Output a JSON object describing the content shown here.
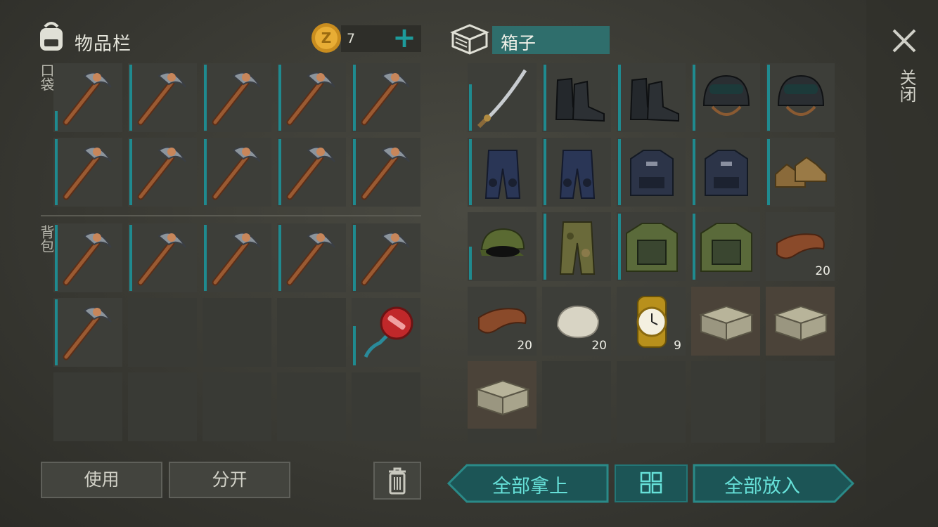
{
  "inventory": {
    "title": "物品栏",
    "coins": "7",
    "plus": "+",
    "pocket_label": "口袋",
    "backpack_label": "背包",
    "pocket": [
      {
        "item": "pickaxe-icon",
        "dur": 0.3
      },
      {
        "item": "pickaxe-icon",
        "dur": 1
      },
      {
        "item": "pickaxe-icon",
        "dur": 1
      },
      {
        "item": "pickaxe-icon",
        "dur": 1
      },
      {
        "item": "pickaxe-icon",
        "dur": 1
      },
      {
        "item": "pickaxe-icon",
        "dur": 1
      },
      {
        "item": "pickaxe-icon",
        "dur": 1
      },
      {
        "item": "pickaxe-icon",
        "dur": 1
      },
      {
        "item": "pickaxe-icon",
        "dur": 1
      },
      {
        "item": "pickaxe-icon",
        "dur": 1
      }
    ],
    "backpack": [
      {
        "item": "pickaxe-icon",
        "dur": 1
      },
      {
        "item": "pickaxe-icon",
        "dur": 1
      },
      {
        "item": "pickaxe-icon",
        "dur": 1
      },
      {
        "item": "pickaxe-icon",
        "dur": 1
      },
      {
        "item": "pickaxe-icon",
        "dur": 1
      },
      {
        "item": "pickaxe-icon",
        "dur": 1
      },
      {
        "item": null
      },
      {
        "item": null
      },
      {
        "item": null
      },
      {
        "item": "stop-sign-icon",
        "dur": 0.6
      },
      {
        "item": null
      },
      {
        "item": null
      },
      {
        "item": null
      },
      {
        "item": null
      },
      {
        "item": null
      }
    ],
    "use_label": "使用",
    "split_label": "分开"
  },
  "box": {
    "title": "箱子",
    "close_label": "关闭",
    "slots": [
      {
        "item": "katana-icon",
        "dur": 0.7
      },
      {
        "item": "boots-icon",
        "dur": 1
      },
      {
        "item": "boots-icon",
        "dur": 1
      },
      {
        "item": "helmet-icon",
        "dur": 1
      },
      {
        "item": "helmet-icon",
        "dur": 1
      },
      {
        "item": "pants-icon",
        "dur": 1
      },
      {
        "item": "pants-icon",
        "dur": 1
      },
      {
        "item": "vest-icon",
        "dur": 1
      },
      {
        "item": "vest-icon",
        "dur": 1
      },
      {
        "item": "shoes-icon",
        "dur": 1
      },
      {
        "item": "cap-icon",
        "dur": 0.5
      },
      {
        "item": "camo-pants-icon",
        "dur": 1
      },
      {
        "item": "camo-vest-icon",
        "dur": 1
      },
      {
        "item": "camo-vest-icon",
        "dur": 1
      },
      {
        "item": "leather-icon",
        "count": "20"
      },
      {
        "item": "leather-icon",
        "count": "20"
      },
      {
        "item": "stone-icon",
        "count": "20"
      },
      {
        "item": "watch-icon",
        "count": "9"
      },
      {
        "item": "crate-icon",
        "wood": true
      },
      {
        "item": "crate-icon",
        "wood": true
      },
      {
        "item": "crate-icon",
        "wood": true
      },
      {
        "item": null
      },
      {
        "item": null
      },
      {
        "item": null
      },
      {
        "item": null
      }
    ],
    "take_all_label": "全部拿上",
    "put_all_label": "全部放入"
  },
  "colors": {
    "accent": "#1f8a8f",
    "teal_text": "#66e0d8"
  }
}
